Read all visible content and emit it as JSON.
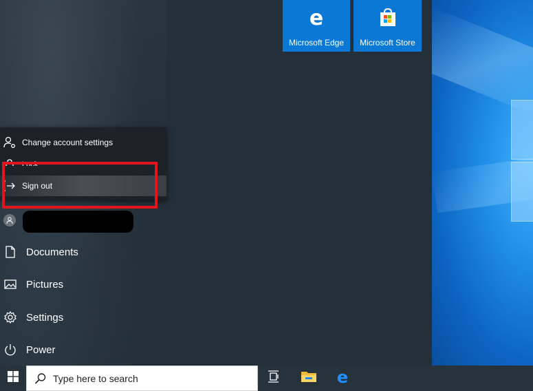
{
  "tiles": [
    {
      "label": "Microsoft Edge",
      "icon": "edge-icon"
    },
    {
      "label": "Microsoft Store",
      "icon": "store-icon"
    }
  ],
  "account_menu": {
    "change_settings": "Change account settings",
    "lock": "Lock",
    "sign_out": "Sign out"
  },
  "user": {
    "name": ""
  },
  "left_menu": {
    "documents": "Documents",
    "pictures": "Pictures",
    "settings": "Settings",
    "power": "Power"
  },
  "taskbar": {
    "search_placeholder": "Type here to search"
  },
  "colors": {
    "accent": "#0a78d4",
    "highlight": "#e3141c",
    "start_bg": "#243039"
  }
}
